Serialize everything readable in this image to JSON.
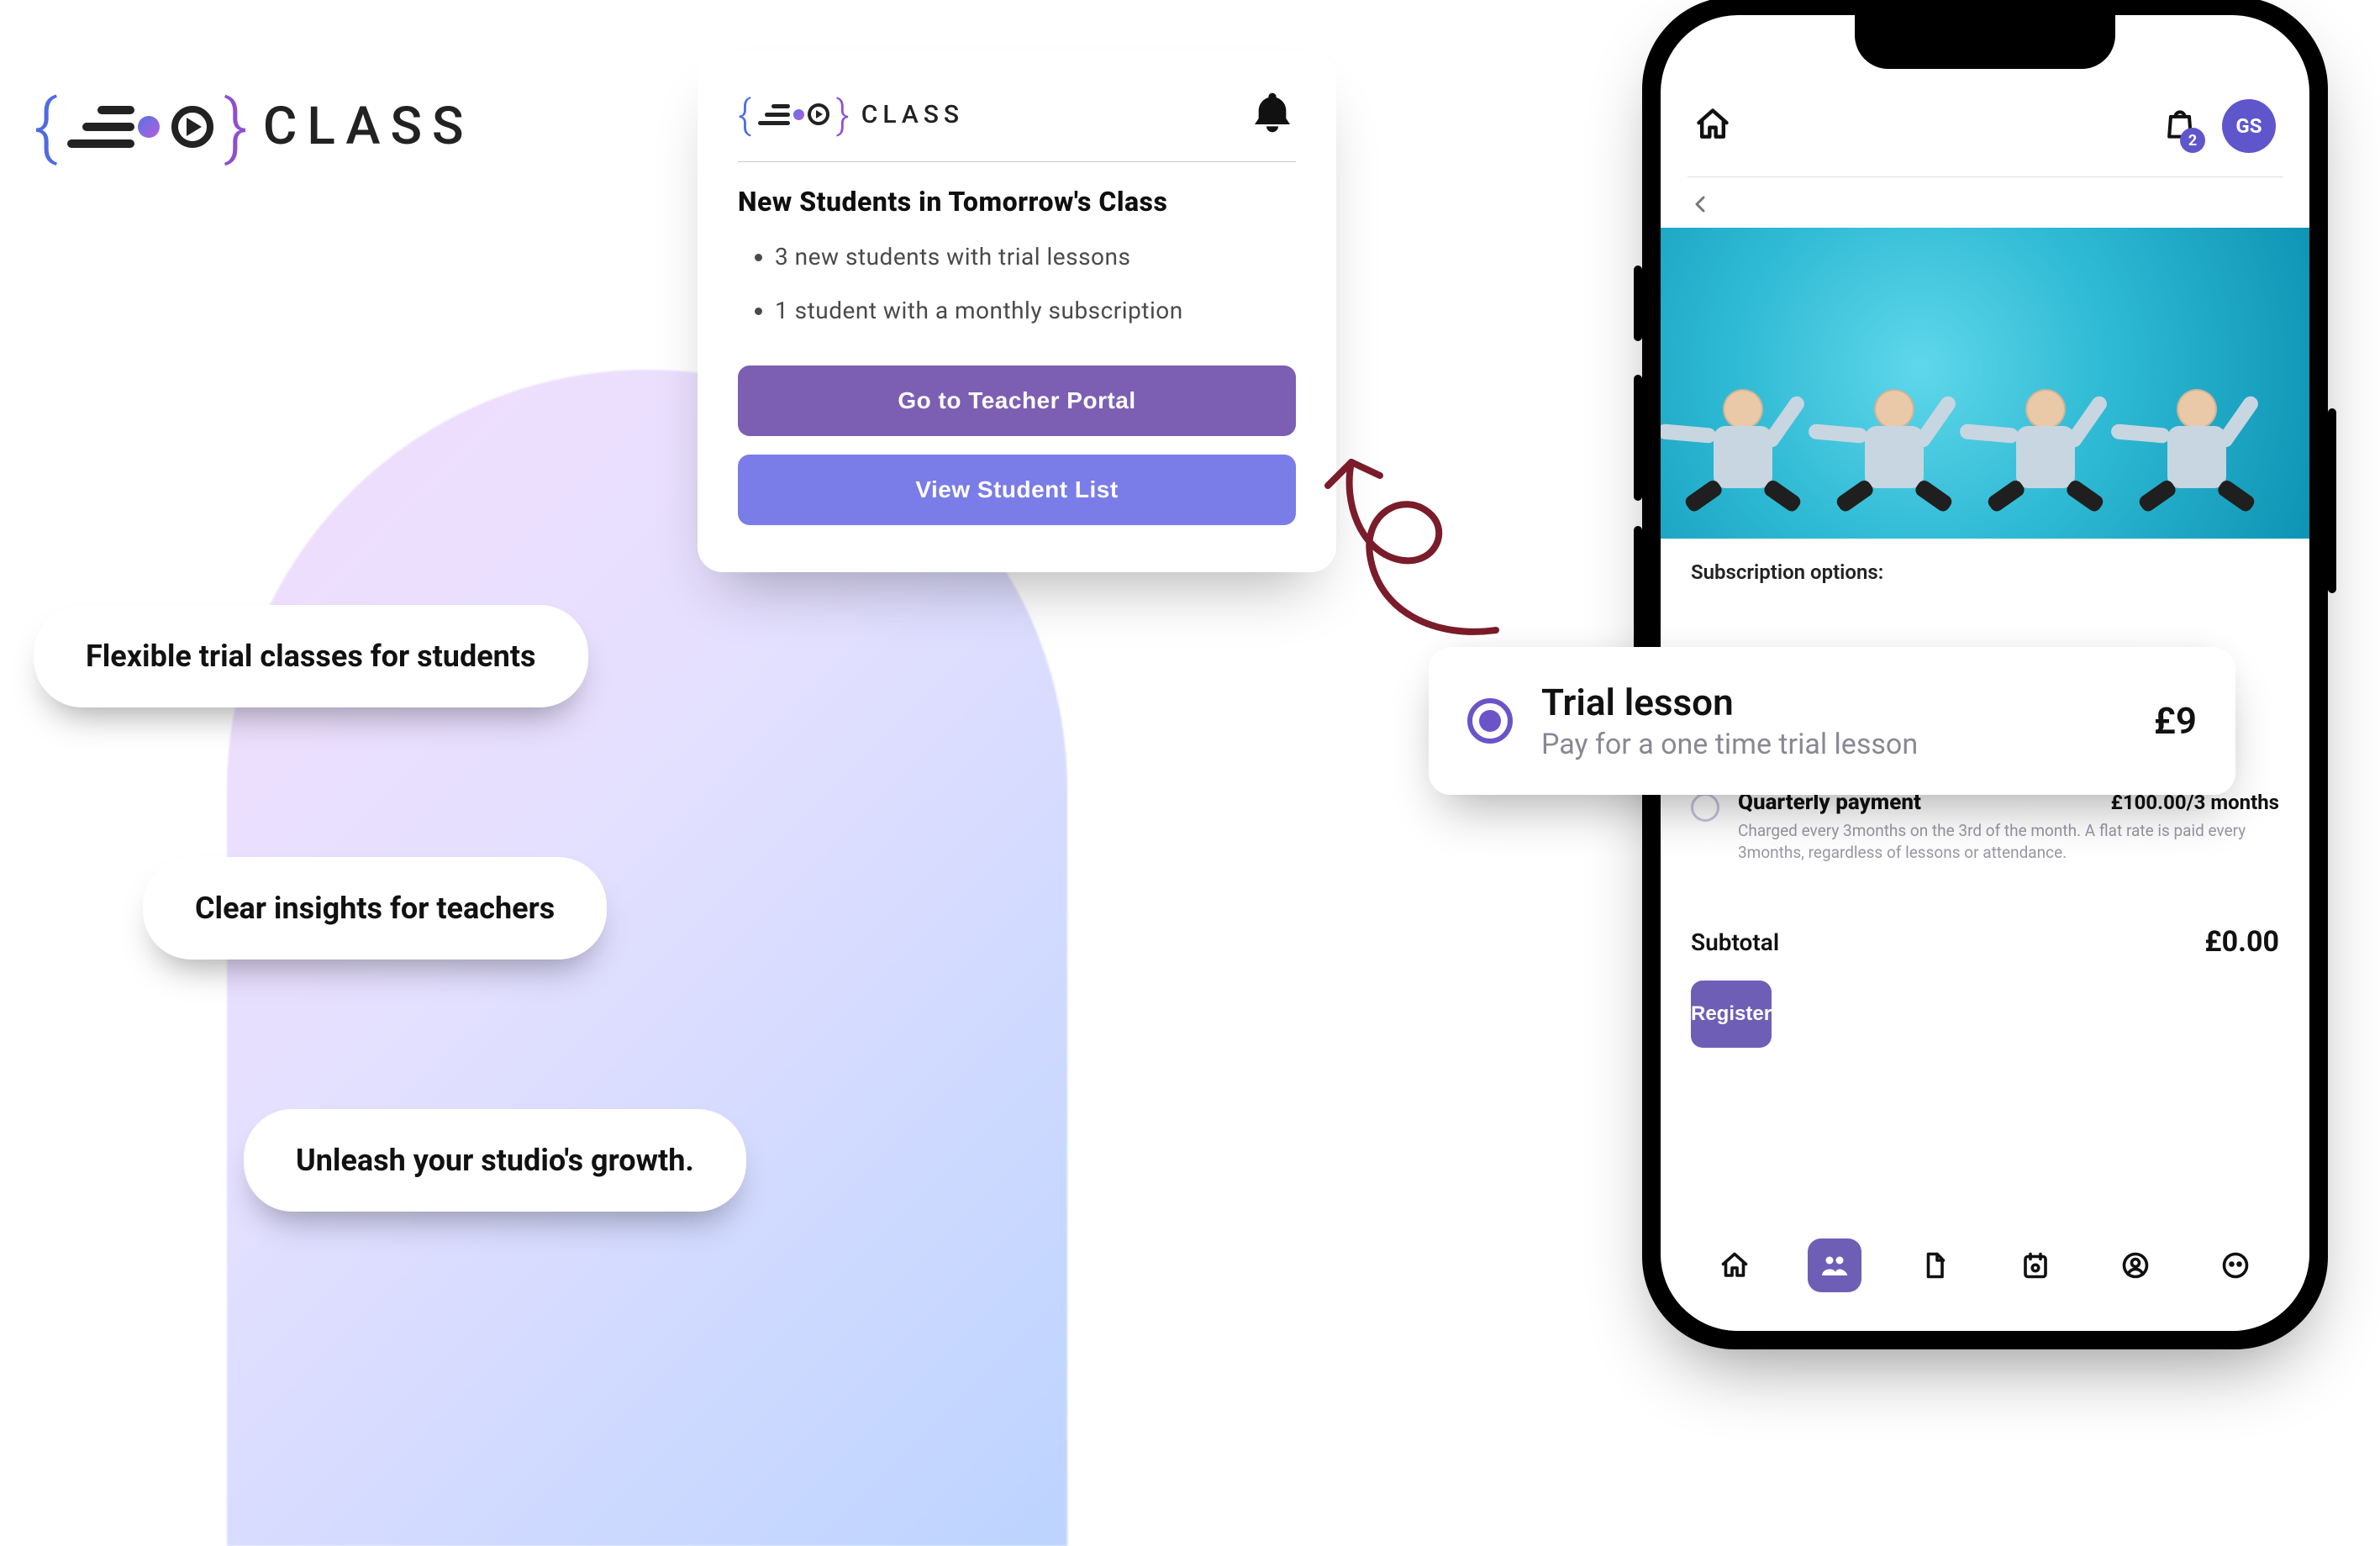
{
  "brand": {
    "name": "CLASS"
  },
  "pills": {
    "p1": "Flexible trial classes for students",
    "p2": "Clear insights for teachers",
    "p3": "Unleash your studio's growth."
  },
  "card": {
    "title": "New Students in Tomorrow's Class",
    "bullets": [
      "3 new students with trial lessons",
      "1 student with a monthly subscription"
    ],
    "primary_label": "Go to Teacher Portal",
    "secondary_label": "View Student List"
  },
  "phone": {
    "avatar_initials": "GS",
    "bag_count": "2",
    "subscription_heading": "Subscription options:",
    "options": [
      {
        "name": "Quarterly payment",
        "price": "£100.00/3 months",
        "desc": "Charged every 3months on the 3rd of the month. A flat rate is paid every 3months, regardless of lessons or attendance."
      }
    ],
    "hidden_option_desc_tail": "of lessons or attendance.",
    "subtotal_label": "Subtotal",
    "subtotal_value": "£0.00",
    "register_label": "Register"
  },
  "popout": {
    "title": "Trial lesson",
    "subtitle": "Pay for a one time trial lesson",
    "price": "£9"
  }
}
